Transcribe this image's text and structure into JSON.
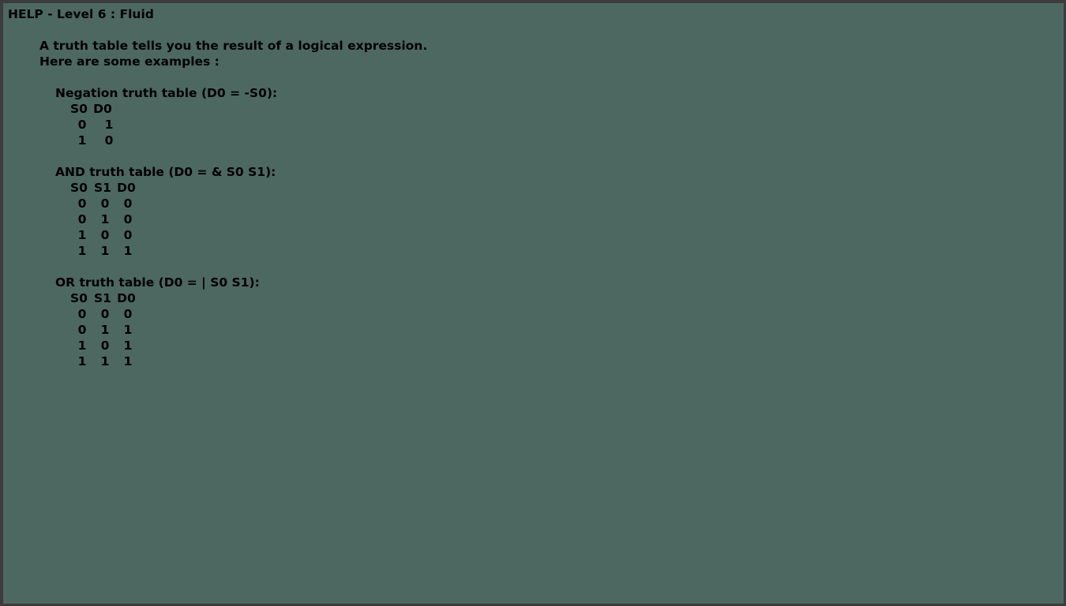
{
  "title": "HELP - Level 6 : Fluid",
  "intro": [
    "A truth table tells you the result of a logical expression.",
    "Here are some examples :"
  ],
  "tables": [
    {
      "heading": "Negation truth table (D0 = -S0):",
      "columns": [
        "S0",
        "D0"
      ],
      "rows": [
        [
          "0",
          "1"
        ],
        [
          "1",
          "0"
        ]
      ]
    },
    {
      "heading": "AND truth table (D0 = & S0 S1):",
      "columns": [
        "S0",
        "S1",
        "D0"
      ],
      "rows": [
        [
          "0",
          "0",
          "0"
        ],
        [
          "0",
          "1",
          "0"
        ],
        [
          "1",
          "0",
          "0"
        ],
        [
          "1",
          "1",
          "1"
        ]
      ]
    },
    {
      "heading": "OR truth table (D0 = | S0 S1):",
      "columns": [
        "S0",
        "S1",
        "D0"
      ],
      "rows": [
        [
          "0",
          "0",
          "0"
        ],
        [
          "0",
          "1",
          "1"
        ],
        [
          "1",
          "0",
          "1"
        ],
        [
          "1",
          "1",
          "1"
        ]
      ]
    }
  ]
}
